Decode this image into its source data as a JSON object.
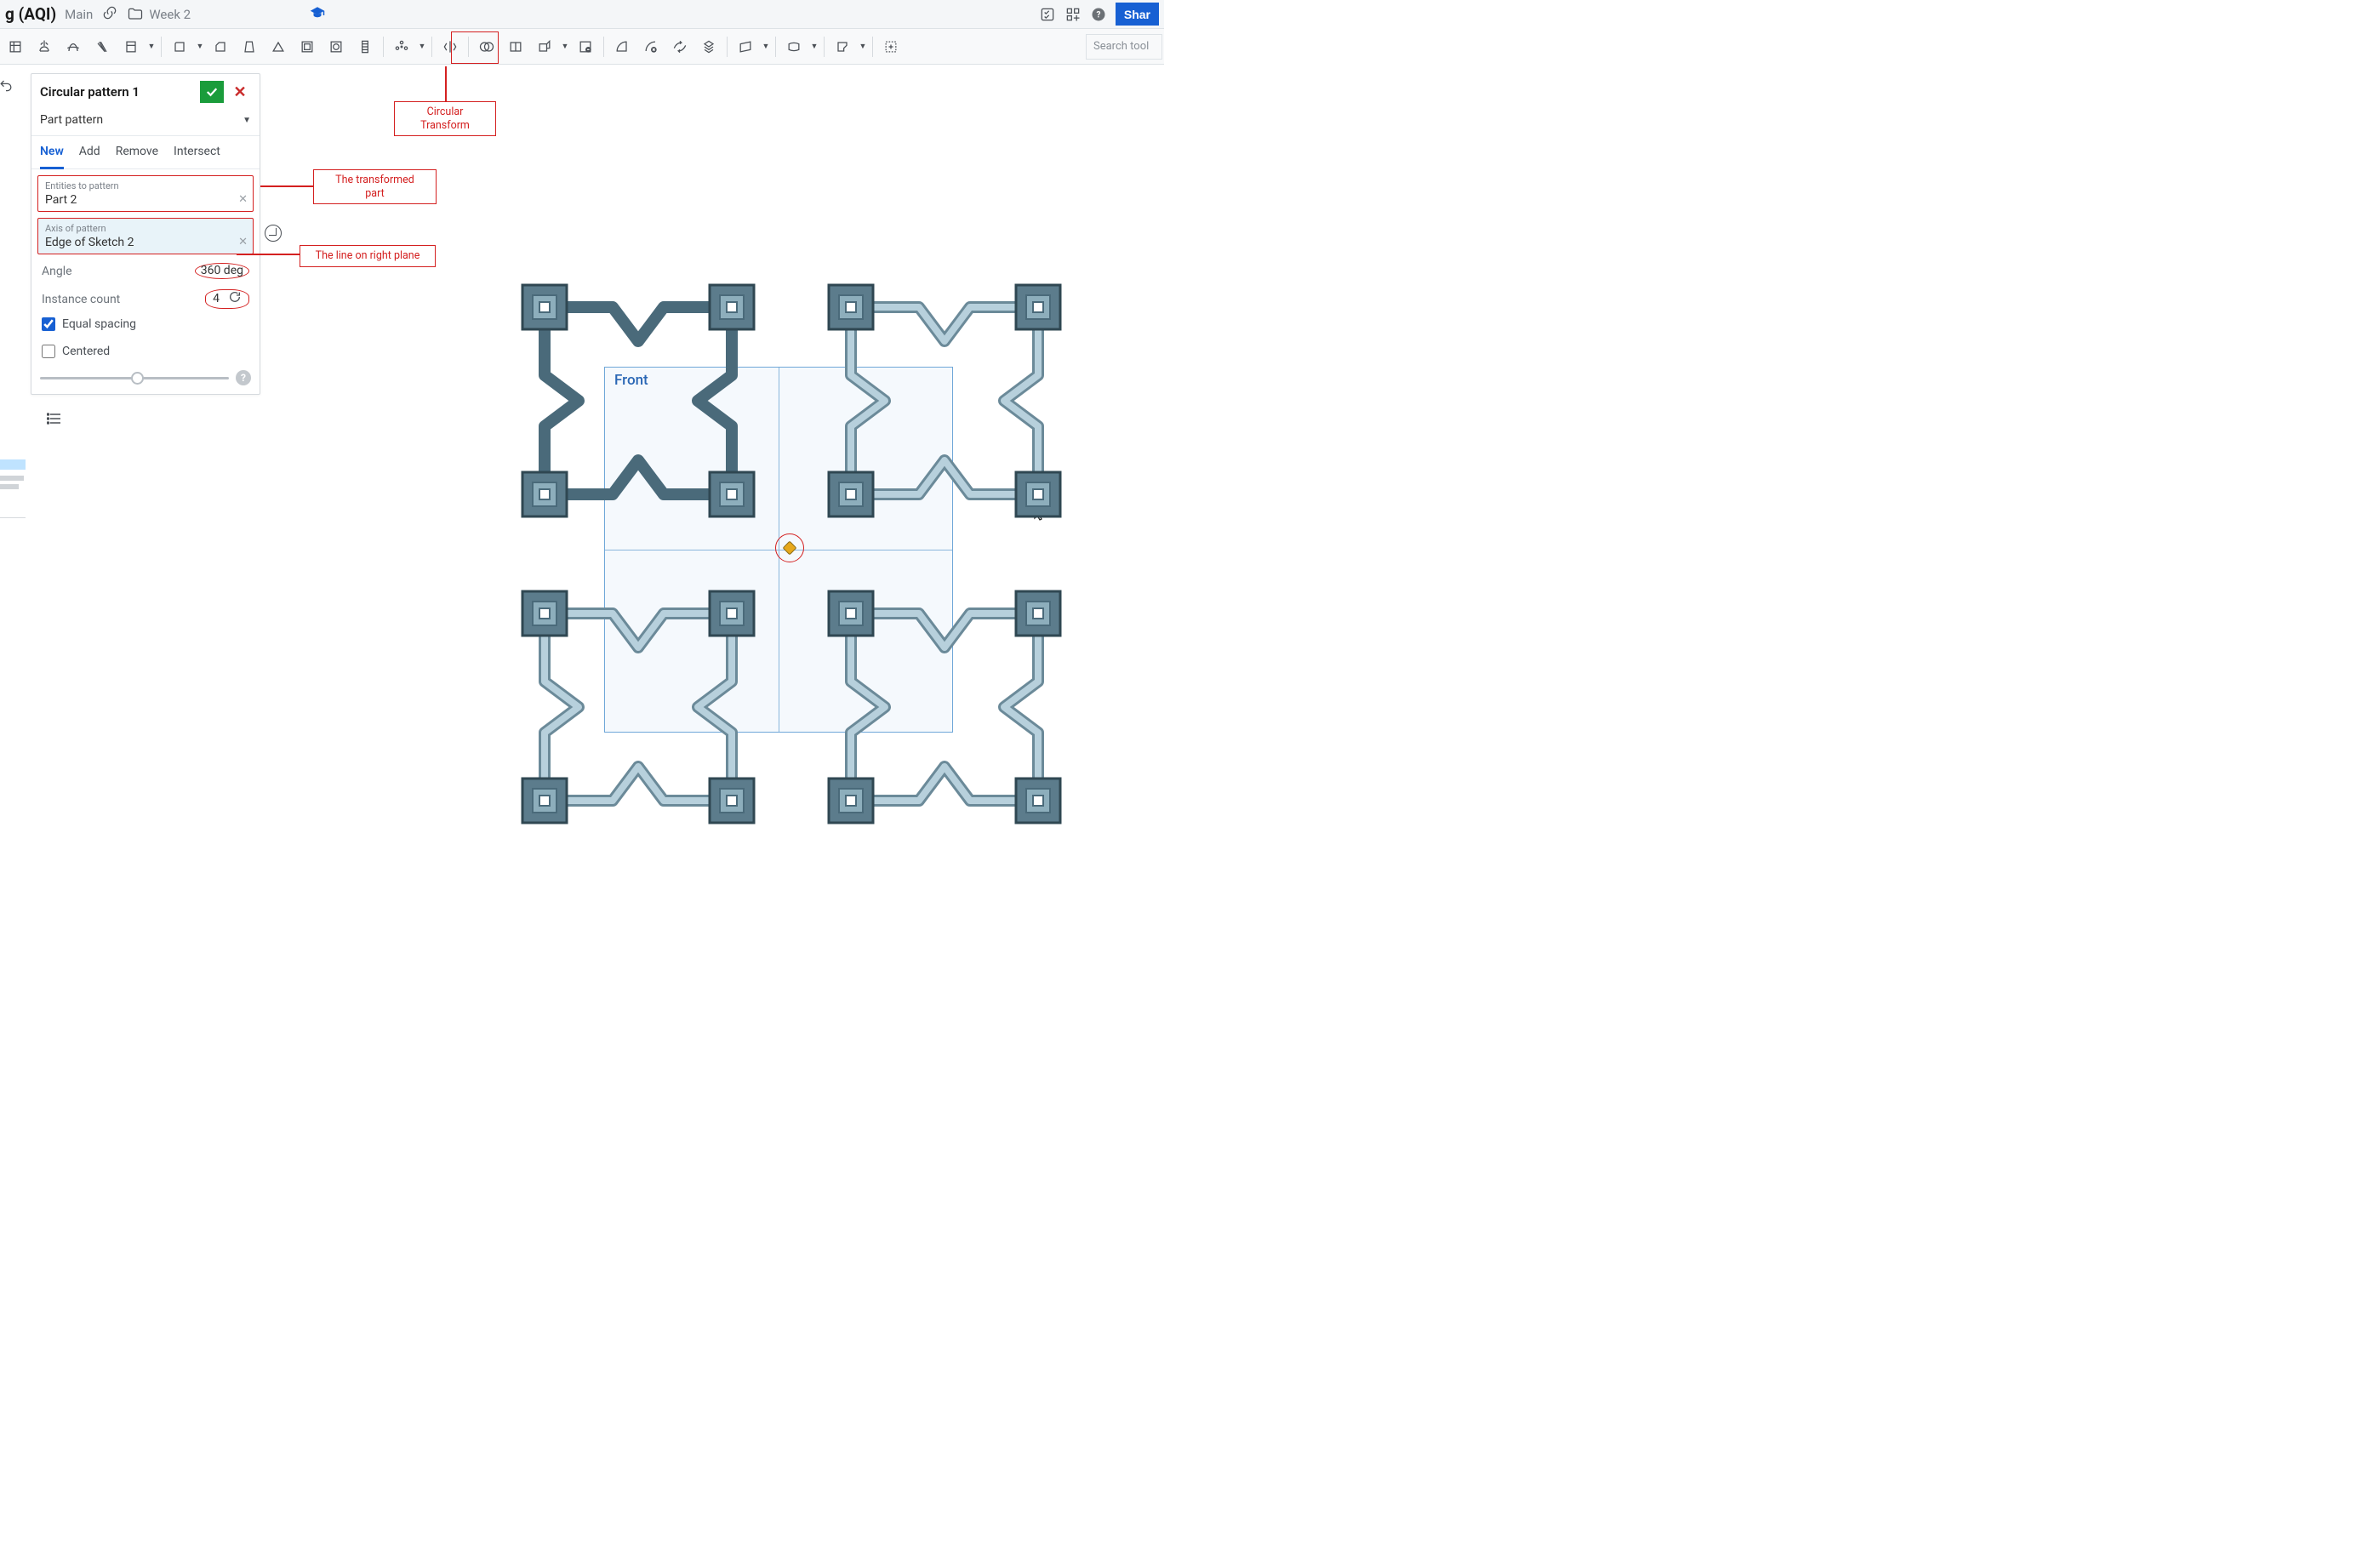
{
  "topbar": {
    "doc_title_suffix": "g (AQI)",
    "branch": "Main",
    "folder": "Week 2",
    "share_label": "Shar"
  },
  "toolbar": {
    "search_placeholder": "Search tool"
  },
  "annotations": {
    "circular_tool": "Circular\nTransform",
    "entities": "The transformed\npart",
    "axis": "The line on right plane"
  },
  "dialog": {
    "title": "Circular pattern 1",
    "type_label": "Part pattern",
    "tabs": {
      "new": "New",
      "add": "Add",
      "remove": "Remove",
      "intersect": "Intersect"
    },
    "entities": {
      "label": "Entities to pattern",
      "value": "Part 2"
    },
    "axis": {
      "label": "Axis of pattern",
      "value": "Edge of Sketch 2"
    },
    "angle": {
      "label": "Angle",
      "value": "360 deg"
    },
    "instance": {
      "label": "Instance count",
      "value": "4"
    },
    "equal_spacing_label": "Equal spacing",
    "equal_spacing_checked": true,
    "centered_label": "Centered",
    "centered_checked": false
  },
  "viewport": {
    "front_label": "Front",
    "cursor_number": "1"
  }
}
